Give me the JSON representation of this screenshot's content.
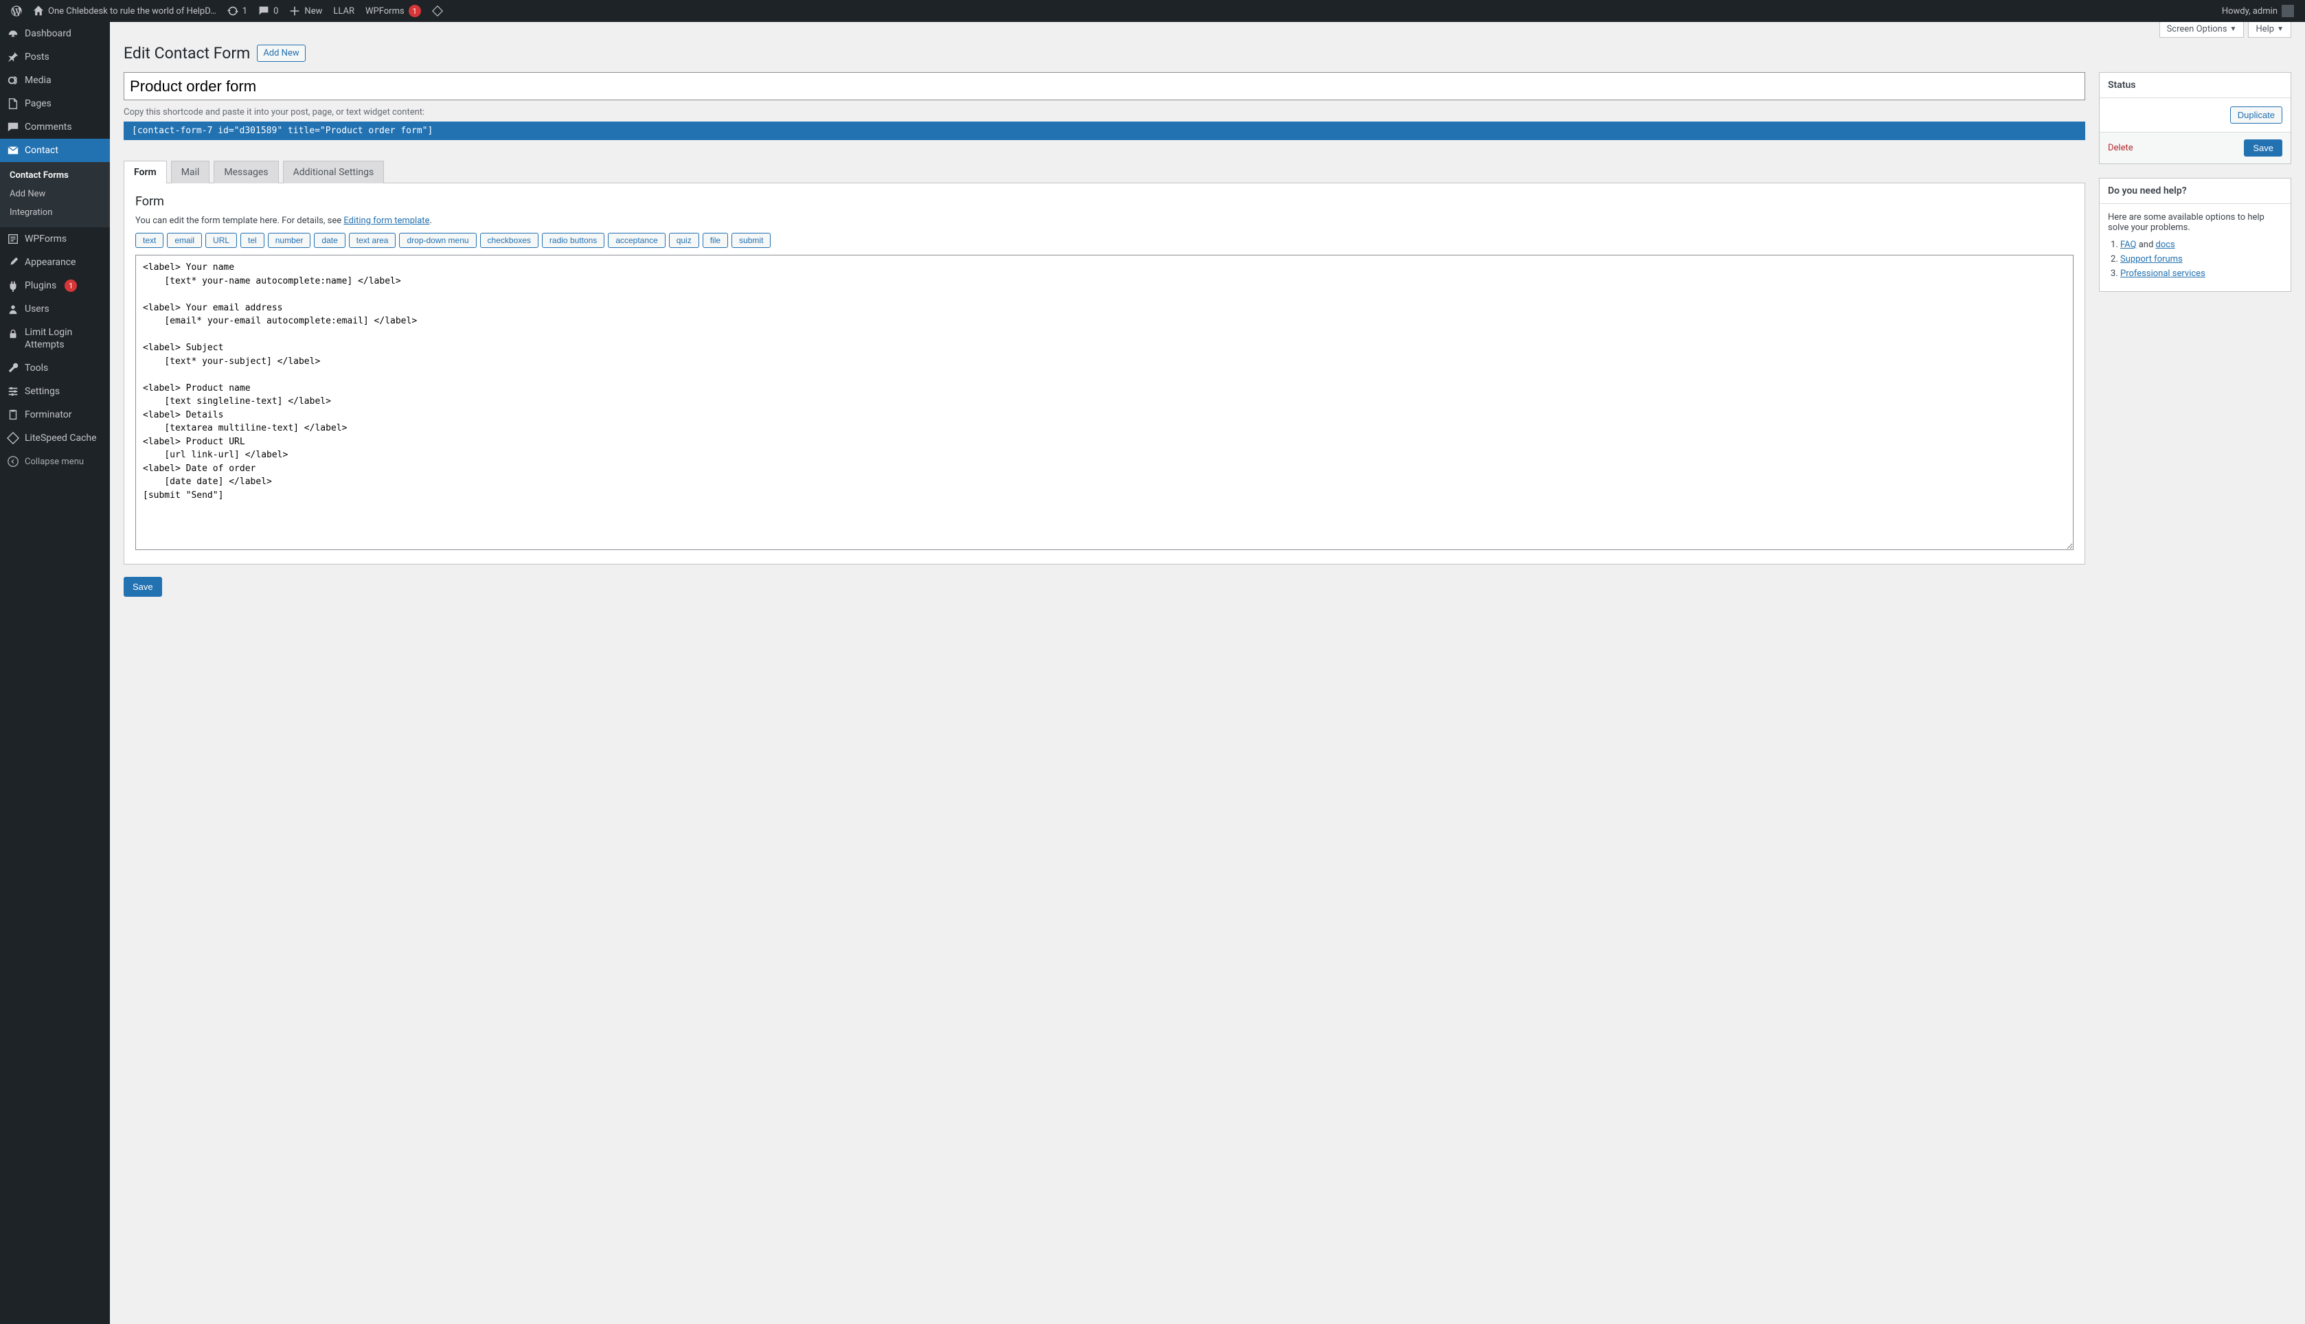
{
  "adminbar": {
    "site_title": "One Chlebdesk to rule the world of HelpD…",
    "updates_count": "1",
    "comments_count": "0",
    "new_label": "New",
    "llar_label": "LLAR",
    "wpforms_label": "WPForms",
    "wpforms_badge": "1",
    "howdy": "Howdy, admin"
  },
  "screen_meta": {
    "screen_options": "Screen Options",
    "help": "Help"
  },
  "sidebar": {
    "dashboard": "Dashboard",
    "posts": "Posts",
    "media": "Media",
    "pages": "Pages",
    "comments": "Comments",
    "contact": "Contact",
    "contact_sub": {
      "contact_forms": "Contact Forms",
      "add_new": "Add New",
      "integration": "Integration"
    },
    "wpforms": "WPForms",
    "appearance": "Appearance",
    "plugins": "Plugins",
    "plugins_badge": "1",
    "users": "Users",
    "limit_login": "Limit Login Attempts",
    "tools": "Tools",
    "settings": "Settings",
    "forminator": "Forminator",
    "litespeed": "LiteSpeed Cache",
    "collapse": "Collapse menu"
  },
  "page": {
    "heading": "Edit Contact Form",
    "add_new": "Add New",
    "form_title": "Product order form",
    "shortcode_desc": "Copy this shortcode and paste it into your post, page, or text widget content:",
    "shortcode": "[contact-form-7 id=\"d301589\" title=\"Product order form\"]"
  },
  "tabs": {
    "form": "Form",
    "mail": "Mail",
    "messages": "Messages",
    "additional": "Additional Settings"
  },
  "panel": {
    "title": "Form",
    "desc_prefix": "You can edit the form template here. For details, see ",
    "desc_link": "Editing form template",
    "desc_suffix": ".",
    "tag_buttons": [
      "text",
      "email",
      "URL",
      "tel",
      "number",
      "date",
      "text area",
      "drop-down menu",
      "checkboxes",
      "radio buttons",
      "acceptance",
      "quiz",
      "file",
      "submit"
    ],
    "form_content": "<label> Your name\n    [text* your-name autocomplete:name] </label>\n\n<label> Your email address\n    [email* your-email autocomplete:email] </label>\n\n<label> Subject\n    [text* your-subject] </label>\n\n<label> Product name\n    [text singleline-text] </label>\n<label> Details\n    [textarea multiline-text] </label>\n<label> Product URL\n    [url link-url] </label>\n<label> Date of order\n    [date date] </label>\n[submit \"Send\"]",
    "save": "Save"
  },
  "status_box": {
    "title": "Status",
    "duplicate": "Duplicate",
    "delete": "Delete",
    "save": "Save"
  },
  "help_box": {
    "title": "Do you need help?",
    "intro": "Here are some available options to help solve your problems.",
    "item1_a": "FAQ",
    "item1_mid": " and ",
    "item1_b": "docs",
    "item2": "Support forums",
    "item3": "Professional services"
  }
}
